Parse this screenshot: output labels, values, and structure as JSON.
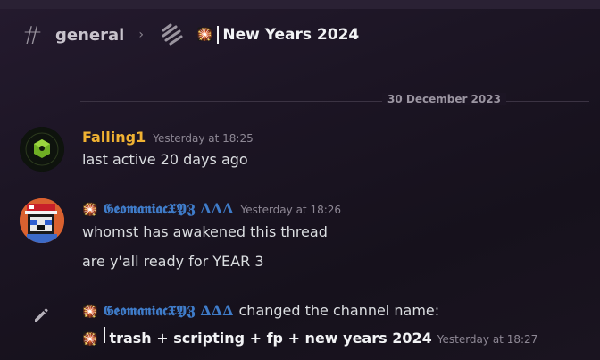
{
  "header": {
    "channel": "general",
    "thread_title": "New Years 2024",
    "spark_glyph": "🎇"
  },
  "divider": {
    "date": "30 December 2023"
  },
  "messages": [
    {
      "author": "Falling1",
      "author_color": "#f0b232",
      "timestamp": "Yesterday at 18:25",
      "lines": [
        "last active 20 days ago"
      ]
    },
    {
      "author_prefix": "🎇",
      "author": "𝕲𝖊𝖔𝖒𝖆𝖓𝖎𝖆𝖈𝖃𝖄𝖅 ΔΔΔ",
      "author_color": "#3f7cc9",
      "timestamp": "Yesterday at 18:26",
      "lines": [
        "whomst has awakened this thread",
        "are y'all ready for YEAR 3"
      ]
    }
  ],
  "system": {
    "author_prefix": "🎇",
    "author": "𝕲𝖊𝖔𝖒𝖆𝖓𝖎𝖆𝖈𝖃𝖄𝖅 ΔΔΔ",
    "action": "changed the channel name:",
    "new_name_prefix": "🎇",
    "new_name": "trash + scripting + fp + new years 2024",
    "timestamp": "Yesterday at 18:27"
  },
  "icons": {
    "hash": "channel-hash-icon",
    "thread": "thread-icon",
    "pencil": "pencil-icon"
  }
}
